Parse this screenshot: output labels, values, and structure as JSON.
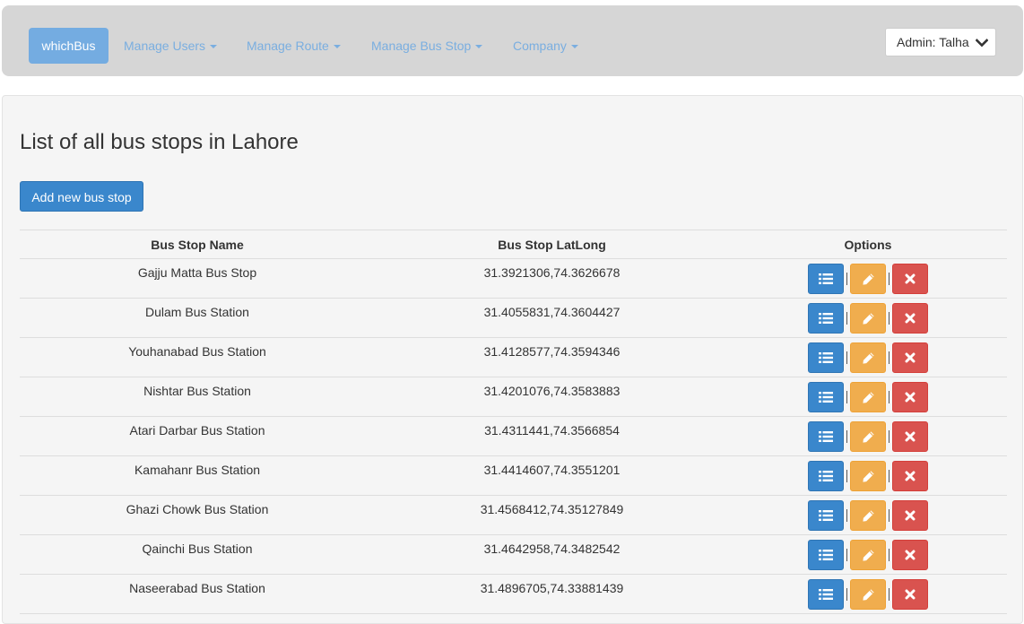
{
  "navbar": {
    "brand": "whichBus",
    "items": [
      {
        "label": "Manage Users"
      },
      {
        "label": "Manage Route"
      },
      {
        "label": "Manage Bus Stop"
      },
      {
        "label": "Company"
      }
    ],
    "admin_label": "Admin: Talha",
    "admin_icon": "chevron-down-icon"
  },
  "main": {
    "title": "List of all bus stops in Lahore",
    "add_button": "Add new bus stop",
    "table": {
      "columns": [
        "Bus Stop Name",
        "Bus Stop LatLong",
        "Options"
      ],
      "rows": [
        {
          "name": "Gajju Matta Bus Stop",
          "latlong": "31.3921306,74.3626678"
        },
        {
          "name": "Dulam Bus Station",
          "latlong": "31.4055831,74.3604427"
        },
        {
          "name": "Youhanabad Bus Station",
          "latlong": "31.4128577,74.3594346"
        },
        {
          "name": "Nishtar Bus Station",
          "latlong": "31.4201076,74.3583883"
        },
        {
          "name": "Atari Darbar Bus Station",
          "latlong": "31.4311441,74.3566854"
        },
        {
          "name": "Kamahanr Bus Station",
          "latlong": "31.4414607,74.3551201"
        },
        {
          "name": "Ghazi Chowk Bus Station",
          "latlong": "31.4568412,74.35127849"
        },
        {
          "name": "Qainchi Bus Station",
          "latlong": "31.4642958,74.3482542"
        },
        {
          "name": "Naseerabad Bus Station",
          "latlong": "31.4896705,74.33881439"
        }
      ],
      "option_icons": [
        "list-icon",
        "pencil-icon",
        "close-icon"
      ]
    }
  },
  "colors": {
    "primary": "#3a87cc",
    "warning": "#f0ad4e",
    "danger": "#d9534f",
    "navbar_bg": "#d6d6d6",
    "brand_bg": "#74ace1",
    "nav_link": "#7aaee0"
  }
}
